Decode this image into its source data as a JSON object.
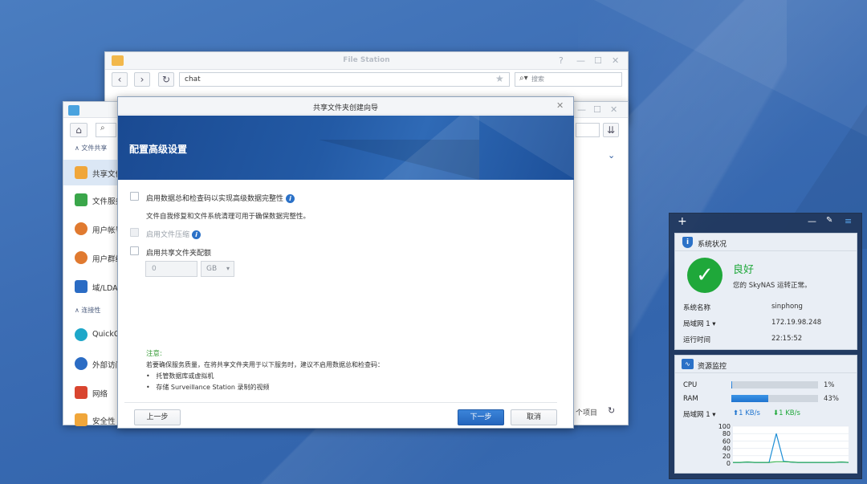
{
  "file_station": {
    "title": "File Station",
    "path": "chat",
    "search_placeholder": "搜索"
  },
  "control_panel": {
    "section_file_sharing": "文件共享",
    "section_connectivity": "连接性",
    "items": [
      {
        "label": "共享文件",
        "icon": "shared-folder-icon",
        "color": "#f0a63a"
      },
      {
        "label": "文件服务",
        "icon": "file-services-icon",
        "color": "#3aa64a"
      },
      {
        "label": "用户帐号",
        "icon": "user-icon",
        "color": "#e07a30"
      },
      {
        "label": "用户群组",
        "icon": "group-icon",
        "color": "#e07a30"
      },
      {
        "label": "域/LDAP",
        "icon": "domain-icon",
        "color": "#2b6cc4"
      },
      {
        "label": "QuickC",
        "icon": "quickconnect-icon",
        "color": "#1ea7c9"
      },
      {
        "label": "外部访问",
        "icon": "globe-icon",
        "color": "#2b6cc4"
      },
      {
        "label": "网络",
        "icon": "home-network-icon",
        "color": "#d9452f"
      },
      {
        "label": "安全性",
        "icon": "security-icon",
        "color": "#f0a63a"
      }
    ],
    "items_count_suffix": "个项目"
  },
  "wizard": {
    "title": "共享文件夹创建向导",
    "header": "配置高级设置",
    "option_checksum": "启用数据总和检查码以实现高级数据完整性",
    "option_checksum_desc": "文件自我修复和文件系统清理可用于确保数据完整性。",
    "option_compression": "启用文件压缩",
    "option_quota": "启用共享文件夹配额",
    "quota_value": "0",
    "quota_unit": "GB",
    "note_label": "注意:",
    "note_text": "若要确保服务质量，在将共享文件夹用于以下服务时，建议不启用数据总和检查码：",
    "note_items": [
      "托管数据库或虚拟机",
      "存储 Surveillance Station 录制的视频"
    ],
    "btn_back": "上一步",
    "btn_next": "下一步",
    "btn_cancel": "取消"
  },
  "system_health": {
    "title": "系统状况",
    "status": "良好",
    "message": "您的 SkyNAS 运转正常。",
    "rows": [
      {
        "key": "系统名称",
        "value": "sinphong"
      },
      {
        "key": "局域网 1 ▾",
        "value": "172.19.98.248"
      },
      {
        "key": "运行时间",
        "value": "22:15:52"
      }
    ]
  },
  "resource_monitor": {
    "title": "资源监控",
    "cpu_label": "CPU",
    "cpu_value": "1%",
    "cpu_fraction": 0.01,
    "ram_label": "RAM",
    "ram_value": "43%",
    "ram_fraction": 0.43,
    "lan_label": "局域网 1 ▾",
    "upload": "1 KB/s",
    "download": "1 KB/s",
    "chart_ticks": [
      "100",
      "80",
      "60",
      "40",
      "20",
      "0"
    ],
    "chart_line": [
      2,
      2,
      3,
      2,
      2,
      2,
      80,
      5,
      3,
      2,
      2,
      2,
      2,
      2,
      2,
      3,
      2
    ]
  },
  "colors": {
    "accent": "#2566bd",
    "good": "#1fa83a"
  }
}
